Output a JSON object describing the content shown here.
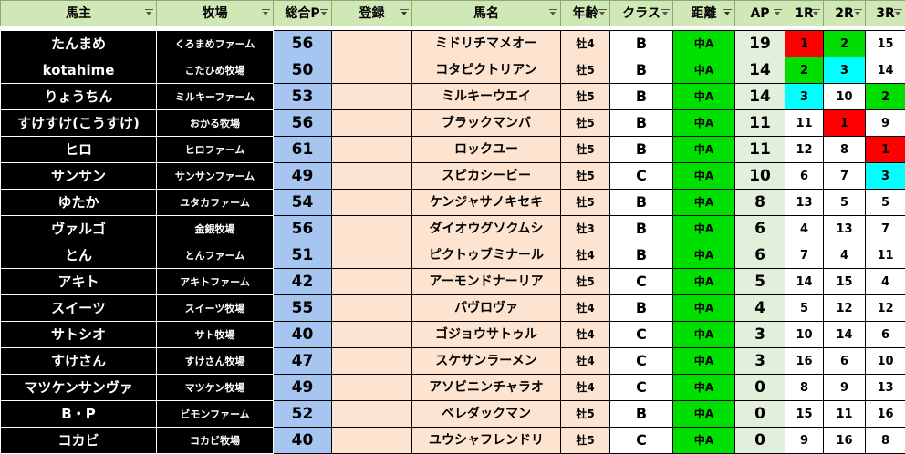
{
  "headers": {
    "owner": "馬主",
    "farm": "牧場",
    "points": "総合P",
    "registration": "登録",
    "horse": "馬名",
    "age": "年齢",
    "class": "クラス",
    "distance": "距離",
    "ap": "AP",
    "r1": "1R",
    "r2": "2R",
    "r3": "3R"
  },
  "rows": [
    {
      "owner": "たんまめ",
      "farm": "くろまめファーム",
      "points": "56",
      "registration": "",
      "horse": "ミドリチマメオー",
      "age": "牡4",
      "class": "B",
      "distance": "中A",
      "ap": "19",
      "r1": "1",
      "r2": "2",
      "r3": "15",
      "r1_color": "red",
      "r2_color": "green",
      "r3_color": ""
    },
    {
      "owner": "kotahime",
      "farm": "こたひめ牧場",
      "points": "50",
      "registration": "",
      "horse": "コタピクトリアン",
      "age": "牡5",
      "class": "B",
      "distance": "中A",
      "ap": "14",
      "r1": "2",
      "r2": "3",
      "r3": "14",
      "r1_color": "green",
      "r2_color": "cyan",
      "r3_color": ""
    },
    {
      "owner": "りょうちん",
      "farm": "ミルキーファーム",
      "points": "53",
      "registration": "",
      "horse": "ミルキーウエイ",
      "age": "牡5",
      "class": "B",
      "distance": "中A",
      "ap": "14",
      "r1": "3",
      "r2": "10",
      "r3": "2",
      "r1_color": "cyan",
      "r2_color": "",
      "r3_color": "green"
    },
    {
      "owner": "すけすけ(こうすけ)",
      "farm": "おかる牧場",
      "points": "56",
      "registration": "",
      "horse": "ブラックマンバ",
      "age": "牡5",
      "class": "B",
      "distance": "中A",
      "ap": "11",
      "r1": "11",
      "r2": "1",
      "r3": "9",
      "r1_color": "",
      "r2_color": "red",
      "r3_color": ""
    },
    {
      "owner": "ヒロ",
      "farm": "ヒロファーム",
      "points": "61",
      "registration": "",
      "horse": "ロックユー",
      "age": "牡5",
      "class": "B",
      "distance": "中A",
      "ap": "11",
      "r1": "12",
      "r2": "8",
      "r3": "1",
      "r1_color": "",
      "r2_color": "",
      "r3_color": "red"
    },
    {
      "owner": "サンサン",
      "farm": "サンサンファーム",
      "points": "49",
      "registration": "",
      "horse": "スピカシービー",
      "age": "牡5",
      "class": "C",
      "distance": "中A",
      "ap": "10",
      "r1": "6",
      "r2": "7",
      "r3": "3",
      "r1_color": "",
      "r2_color": "",
      "r3_color": "cyan"
    },
    {
      "owner": "ゆたか",
      "farm": "ユタカファーム",
      "points": "54",
      "registration": "",
      "horse": "ケンジャサノキセキ",
      "age": "牡5",
      "class": "B",
      "distance": "中A",
      "ap": "8",
      "r1": "13",
      "r2": "5",
      "r3": "5",
      "r1_color": "",
      "r2_color": "",
      "r3_color": ""
    },
    {
      "owner": "ヴァルゴ",
      "farm": "金銀牧場",
      "points": "56",
      "registration": "",
      "horse": "ダイオウグソクムシ",
      "age": "牡3",
      "class": "B",
      "distance": "中A",
      "ap": "6",
      "r1": "4",
      "r2": "13",
      "r3": "7",
      "r1_color": "",
      "r2_color": "",
      "r3_color": ""
    },
    {
      "owner": "とん",
      "farm": "とんファーム",
      "points": "51",
      "registration": "",
      "horse": "ピクトゥブミナール",
      "age": "牡4",
      "class": "B",
      "distance": "中A",
      "ap": "6",
      "r1": "7",
      "r2": "4",
      "r3": "11",
      "r1_color": "",
      "r2_color": "",
      "r3_color": ""
    },
    {
      "owner": "アキト",
      "farm": "アキトファーム",
      "points": "42",
      "registration": "",
      "horse": "アーモンドナーリア",
      "age": "牡5",
      "class": "C",
      "distance": "中A",
      "ap": "5",
      "r1": "14",
      "r2": "15",
      "r3": "4",
      "r1_color": "",
      "r2_color": "",
      "r3_color": ""
    },
    {
      "owner": "スイーツ",
      "farm": "スイーツ牧場",
      "points": "55",
      "registration": "",
      "horse": "パヴロヴァ",
      "age": "牡4",
      "class": "B",
      "distance": "中A",
      "ap": "4",
      "r1": "5",
      "r2": "12",
      "r3": "12",
      "r1_color": "",
      "r2_color": "",
      "r3_color": ""
    },
    {
      "owner": "サトシオ",
      "farm": "サト牧場",
      "points": "40",
      "registration": "",
      "horse": "ゴジョウサトゥル",
      "age": "牡4",
      "class": "C",
      "distance": "中A",
      "ap": "3",
      "r1": "10",
      "r2": "14",
      "r3": "6",
      "r1_color": "",
      "r2_color": "",
      "r3_color": ""
    },
    {
      "owner": "すけさん",
      "farm": "すけさん牧場",
      "points": "47",
      "registration": "",
      "horse": "スケサンラーメン",
      "age": "牡4",
      "class": "C",
      "distance": "中A",
      "ap": "3",
      "r1": "16",
      "r2": "6",
      "r3": "10",
      "r1_color": "",
      "r2_color": "",
      "r3_color": ""
    },
    {
      "owner": "マツケンサンヴァ",
      "farm": "マツケン牧場",
      "points": "49",
      "registration": "",
      "horse": "アソビニンチャラオ",
      "age": "牡4",
      "class": "C",
      "distance": "中A",
      "ap": "0",
      "r1": "8",
      "r2": "9",
      "r3": "13",
      "r1_color": "",
      "r2_color": "",
      "r3_color": ""
    },
    {
      "owner": "B・P",
      "farm": "ビモンファーム",
      "points": "52",
      "registration": "",
      "horse": "ベレダックマン",
      "age": "牡5",
      "class": "B",
      "distance": "中A",
      "ap": "0",
      "r1": "15",
      "r2": "11",
      "r3": "16",
      "r1_color": "",
      "r2_color": "",
      "r3_color": ""
    },
    {
      "owner": "コカビ",
      "farm": "コカビ牧場",
      "points": "40",
      "registration": "",
      "horse": "ユウシャフレンドリ",
      "age": "牡5",
      "class": "C",
      "distance": "中A",
      "ap": "0",
      "r1": "9",
      "r2": "16",
      "r3": "8",
      "r1_color": "",
      "r2_color": "",
      "r3_color": ""
    }
  ]
}
